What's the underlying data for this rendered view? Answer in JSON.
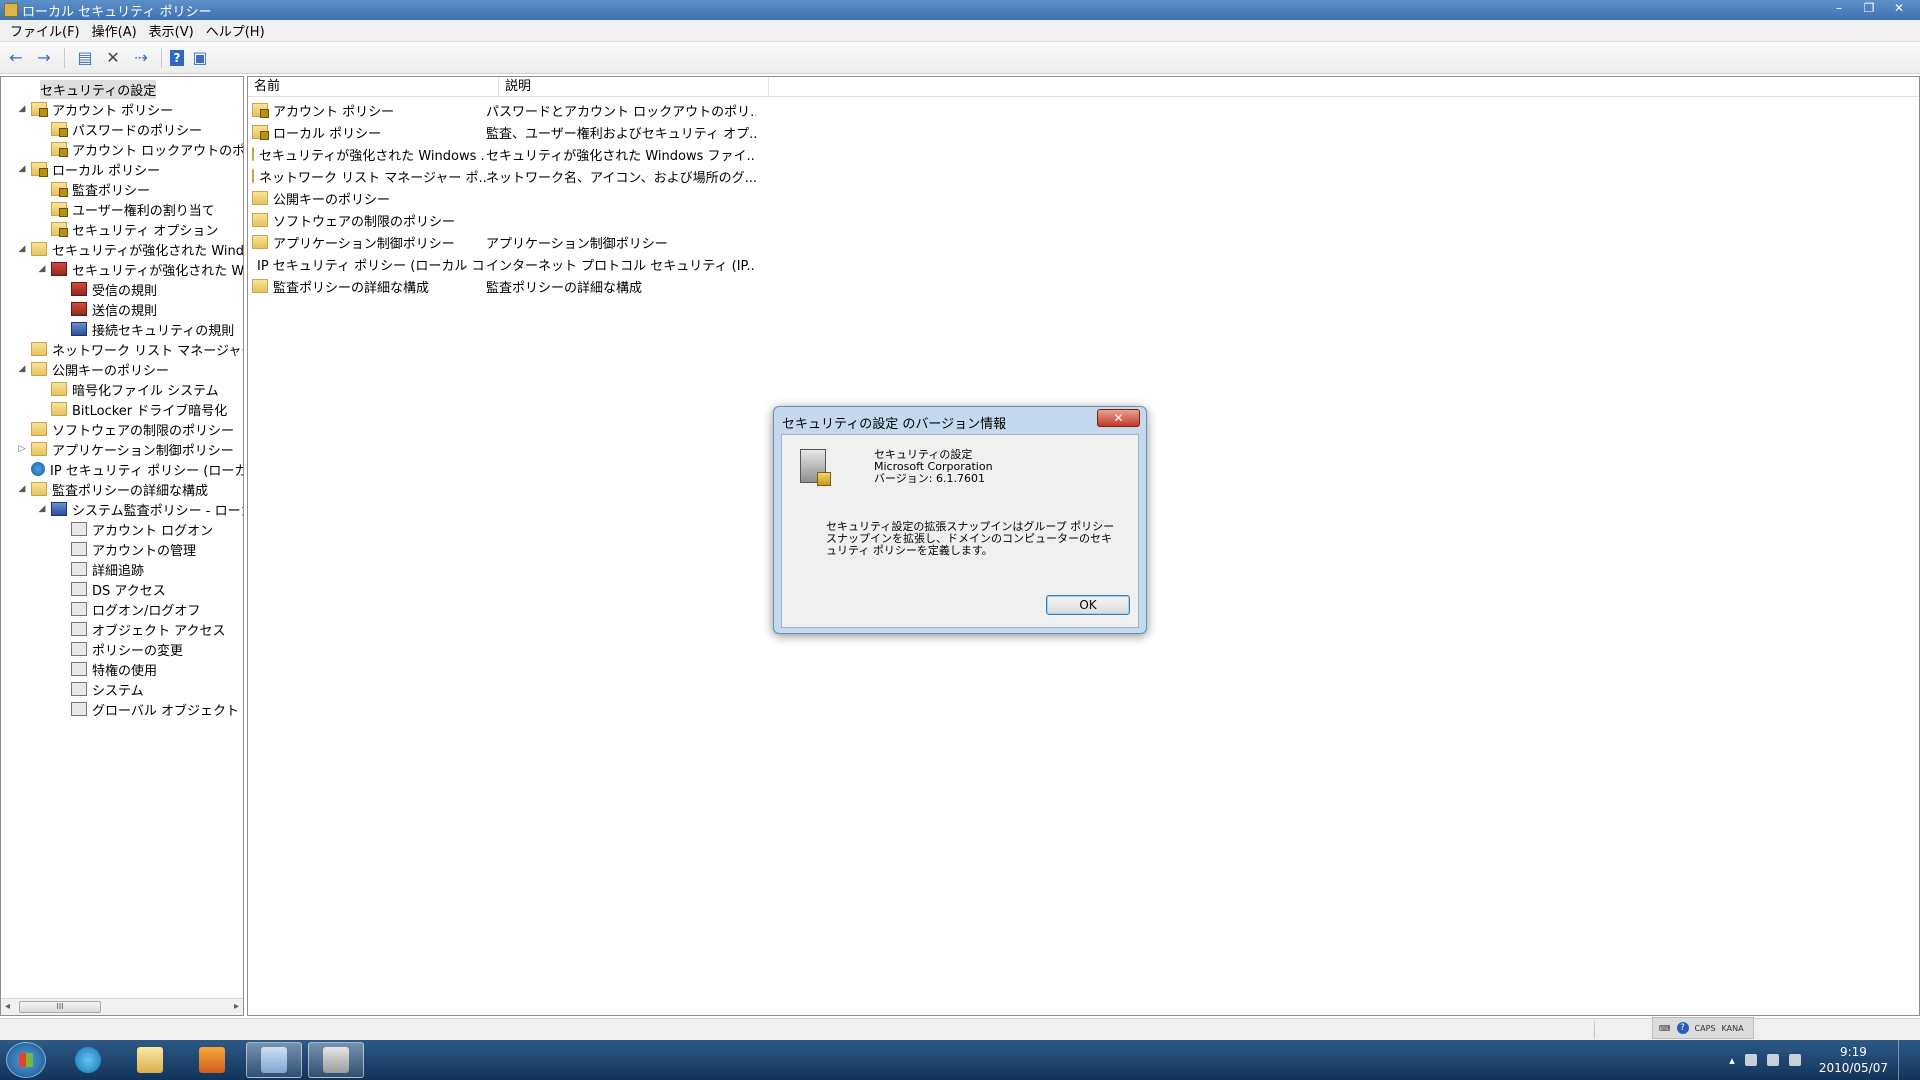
{
  "window": {
    "title": "ローカル セキュリティ ポリシー",
    "controls": [
      "–",
      "❐",
      "✕"
    ]
  },
  "menubar": [
    "ファイル(F)",
    "操作(A)",
    "表示(V)",
    "ヘルプ(H)"
  ],
  "toolbar": {
    "icons": [
      "back-arrow-icon",
      "forward-arrow-icon",
      "show-hide-console-tree-icon",
      "delete-icon",
      "export-list-icon",
      "help-icon",
      "action-pane-icon"
    ]
  },
  "tree": {
    "items": [
      {
        "label": "セキュリティの設定",
        "icon": "root",
        "indent": 0,
        "arrow": "",
        "selected": true
      },
      {
        "label": "アカウント ポリシー",
        "icon": "lockfolder",
        "indent": 1,
        "arrow": "◢"
      },
      {
        "label": "パスワードのポリシー",
        "icon": "lockfolder",
        "indent": 2,
        "arrow": ""
      },
      {
        "label": "アカウント ロックアウトのポリシー",
        "icon": "lockfolder",
        "indent": 2,
        "arrow": ""
      },
      {
        "label": "ローカル ポリシー",
        "icon": "lockfolder",
        "indent": 1,
        "arrow": "◢"
      },
      {
        "label": "監査ポリシー",
        "icon": "lockfolder",
        "indent": 2,
        "arrow": ""
      },
      {
        "label": "ユーザー権利の割り当て",
        "icon": "lockfolder",
        "indent": 2,
        "arrow": ""
      },
      {
        "label": "セキュリティ オプション",
        "icon": "lockfolder",
        "indent": 2,
        "arrow": ""
      },
      {
        "label": "セキュリティが強化された Windows ファイアウォール",
        "icon": "folder",
        "indent": 1,
        "arrow": "◢"
      },
      {
        "label": "セキュリティが強化された Windows ファイアウォール",
        "icon": "firewall",
        "indent": 2,
        "arrow": "◢"
      },
      {
        "label": "受信の規則",
        "icon": "firewall",
        "indent": 3,
        "arrow": ""
      },
      {
        "label": "送信の規則",
        "icon": "firewall",
        "indent": 3,
        "arrow": ""
      },
      {
        "label": "接続セキュリティの規則",
        "icon": "netsec",
        "indent": 3,
        "arrow": ""
      },
      {
        "label": "ネットワーク リスト マネージャー ポリシー",
        "icon": "folder",
        "indent": 1,
        "arrow": ""
      },
      {
        "label": "公開キーのポリシー",
        "icon": "folder",
        "indent": 1,
        "arrow": "◢"
      },
      {
        "label": "暗号化ファイル システム",
        "icon": "folder",
        "indent": 2,
        "arrow": ""
      },
      {
        "label": "BitLocker ドライブ暗号化",
        "icon": "folder",
        "indent": 2,
        "arrow": ""
      },
      {
        "label": "ソフトウェアの制限のポリシー",
        "icon": "folder",
        "indent": 1,
        "arrow": ""
      },
      {
        "label": "アプリケーション制御ポリシー",
        "icon": "folder",
        "indent": 1,
        "arrow": "▷"
      },
      {
        "label": "IP セキュリティ ポリシー (ローカル コンピューター)",
        "icon": "globe",
        "indent": 1,
        "arrow": ""
      },
      {
        "label": "監査ポリシーの詳細な構成",
        "icon": "folder",
        "indent": 1,
        "arrow": "◢"
      },
      {
        "label": "システム監査ポリシー - ローカル グループ ポリシー オブジェクト",
        "icon": "netsec",
        "indent": 2,
        "arrow": "◢"
      },
      {
        "label": "アカウント ログオン",
        "icon": "audit",
        "indent": 3,
        "arrow": ""
      },
      {
        "label": "アカウントの管理",
        "icon": "audit",
        "indent": 3,
        "arrow": ""
      },
      {
        "label": "詳細追跡",
        "icon": "audit",
        "indent": 3,
        "arrow": ""
      },
      {
        "label": "DS アクセス",
        "icon": "audit",
        "indent": 3,
        "arrow": ""
      },
      {
        "label": "ログオン/ログオフ",
        "icon": "audit",
        "indent": 3,
        "arrow": ""
      },
      {
        "label": "オブジェクト アクセス",
        "icon": "audit",
        "indent": 3,
        "arrow": ""
      },
      {
        "label": "ポリシーの変更",
        "icon": "audit",
        "indent": 3,
        "arrow": ""
      },
      {
        "label": "特権の使用",
        "icon": "audit",
        "indent": 3,
        "arrow": ""
      },
      {
        "label": "システム",
        "icon": "audit",
        "indent": 3,
        "arrow": ""
      },
      {
        "label": "グローバル オブジェクト アクセスの監査",
        "icon": "audit",
        "indent": 3,
        "arrow": ""
      }
    ],
    "scrollbar_thumb_label": "III"
  },
  "list": {
    "columns": [
      "名前",
      "説明"
    ],
    "rows": [
      {
        "name": "アカウント ポリシー",
        "desc": "パスワードとアカウント ロックアウトのポリ...",
        "icon": "lockfolder"
      },
      {
        "name": "ローカル ポリシー",
        "desc": "監査、ユーザー権利およびセキュリティ オプ...",
        "icon": "lockfolder"
      },
      {
        "name": "セキュリティが強化された Windows ...",
        "desc": "セキュリティが強化された Windows ファイ...",
        "icon": "folder"
      },
      {
        "name": "ネットワーク リスト マネージャー ポ...",
        "desc": "ネットワーク名、アイコン、および場所のグ...",
        "icon": "folder"
      },
      {
        "name": "公開キーのポリシー",
        "desc": "",
        "icon": "folder"
      },
      {
        "name": "ソフトウェアの制限のポリシー",
        "desc": "",
        "icon": "folder"
      },
      {
        "name": "アプリケーション制御ポリシー",
        "desc": "アプリケーション制御ポリシー",
        "icon": "folder"
      },
      {
        "name": "IP セキュリティ ポリシー (ローカル コ...",
        "desc": "インターネット プロトコル セキュリティ (IP...",
        "icon": "globe"
      },
      {
        "name": "監査ポリシーの詳細な構成",
        "desc": "監査ポリシーの詳細な構成",
        "icon": "folder"
      }
    ]
  },
  "dialog": {
    "title": "セキュリティの設定 のバージョン情報",
    "close_label": "✕",
    "product": "セキュリティの設定",
    "company": "Microsoft Corporation",
    "version": "バージョン: 6.1.7601",
    "description": "セキュリティ設定の拡張スナップインはグループ ポリシー スナップインを拡張し、ドメインのコンピューターのセキュリティ ポリシーを定義します。",
    "ok_label": "OK"
  },
  "langbar": {
    "caps": "CAPS",
    "kana": "KANA"
  },
  "taskbar": {
    "time": "9:19",
    "date": "2010/05/07",
    "apps": [
      "internet-explorer",
      "windows-explorer",
      "media-player",
      "mmc-console",
      "local-security-policy"
    ]
  }
}
